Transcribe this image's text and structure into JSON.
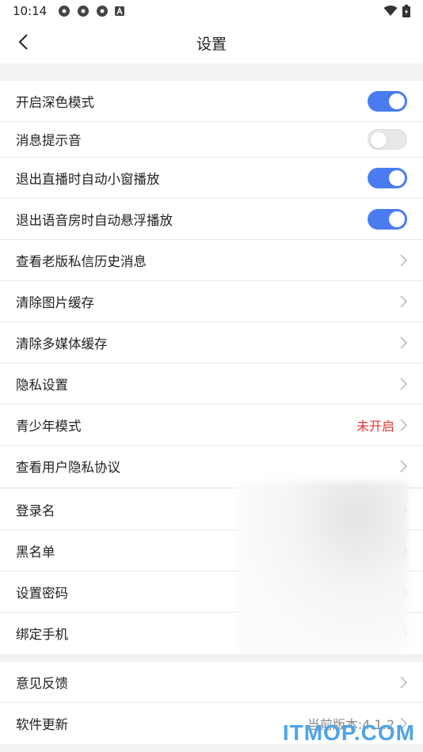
{
  "status_bar": {
    "time": "10:14"
  },
  "header": {
    "title": "设置"
  },
  "group1": [
    {
      "label": "开启深色模式",
      "type": "toggle",
      "state": "on"
    },
    {
      "label": "消息提示音",
      "type": "toggle",
      "state": "off"
    },
    {
      "label": "退出直播时自动小窗播放",
      "type": "toggle",
      "state": "on"
    },
    {
      "label": "退出语音房时自动悬浮播放",
      "type": "toggle",
      "state": "on"
    },
    {
      "label": "查看老版私信历史消息",
      "type": "link"
    },
    {
      "label": "清除图片缓存",
      "type": "link"
    },
    {
      "label": "清除多媒体缓存",
      "type": "link"
    },
    {
      "label": "隐私设置",
      "type": "link"
    },
    {
      "label": "青少年模式",
      "type": "link",
      "value": "未开启"
    },
    {
      "label": "查看用户隐私协议",
      "type": "link"
    }
  ],
  "group2": [
    {
      "label": "登录名"
    },
    {
      "label": "黑名单"
    },
    {
      "label": "设置密码"
    },
    {
      "label": "绑定手机"
    }
  ],
  "group3": [
    {
      "label": "意见反馈"
    },
    {
      "label": "软件更新",
      "value": "当前版本:4.1.2"
    }
  ],
  "colors": {
    "accent": "#4a7cf0",
    "warning": "#e53935"
  },
  "watermark": "ITMOP.COM"
}
